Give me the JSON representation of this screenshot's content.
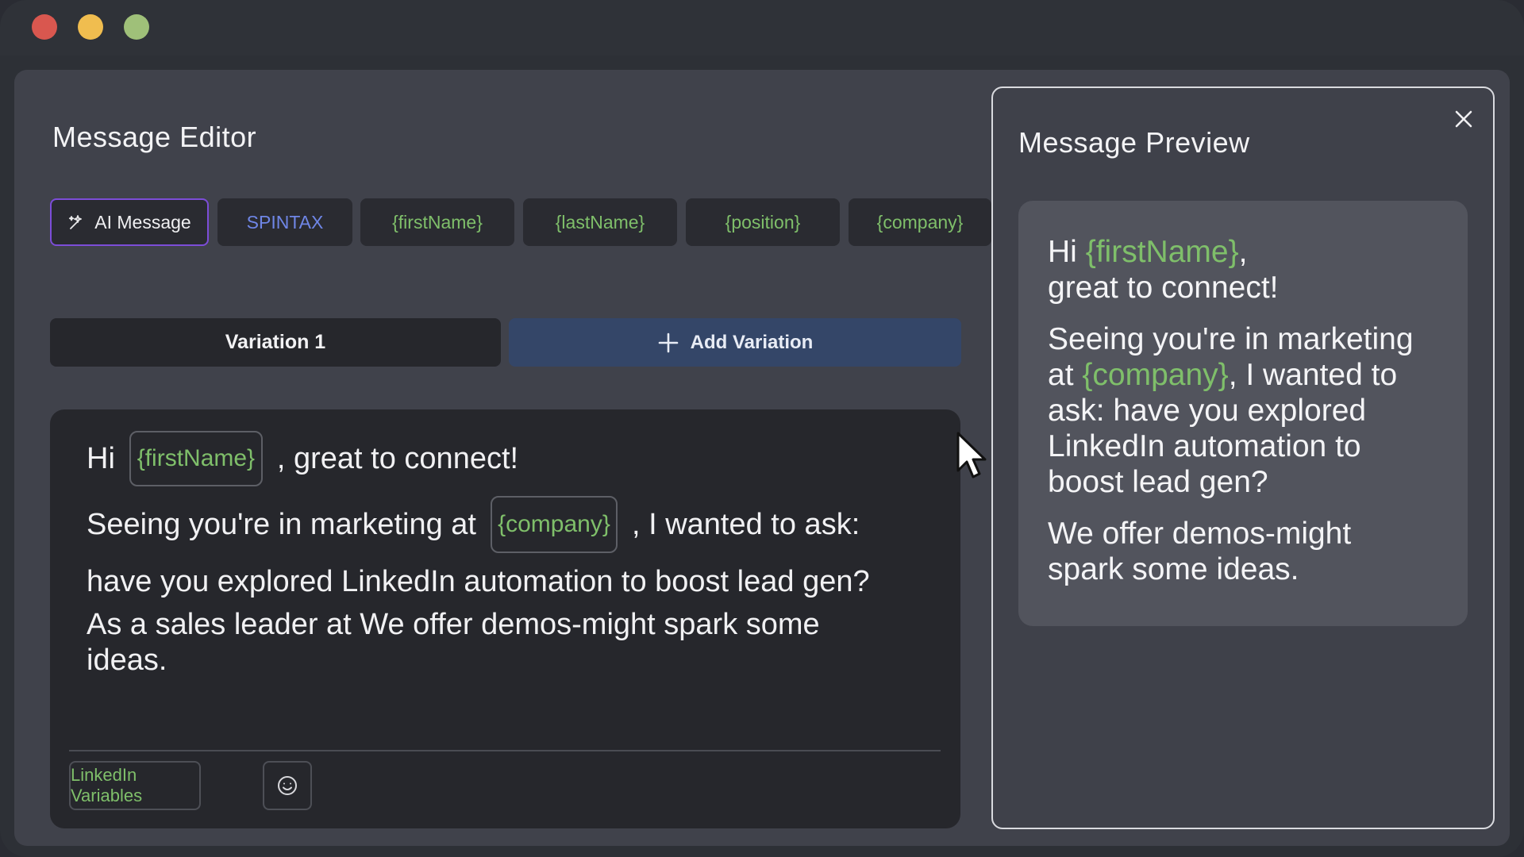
{
  "editor": {
    "title": "Message Editor",
    "chips": {
      "ai": "AI Message",
      "spintax": "SPINTAX",
      "firstName": "{firstName}",
      "lastName": "{lastName}",
      "position": "{position}",
      "company": "{company}"
    },
    "variation_tab": "Variation 1",
    "add_variation": "Add Variation",
    "message": {
      "hi": "Hi",
      "var_firstName": "{firstName}",
      "after_firstName": ", great to connect!",
      "seeing": "Seeing you're in marketing at",
      "var_company": "{company}",
      "after_company": ", I wanted to ask:",
      "line3": "have you explored LinkedIn automation to boost lead gen?",
      "line4": "As a sales leader at  We offer demos-might spark some",
      "line5": "ideas."
    },
    "linkedin_variables": "LinkedIn Variables"
  },
  "preview": {
    "title": "Message Preview",
    "hi": "Hi",
    "firstName": "{firstName}",
    "comma": ",",
    "great": "great to connect!",
    "p2a": "Seeing you're in marketing",
    "p2b_at": "at",
    "company": "{company}",
    "p2b_rest": ", I wanted to",
    "p2c": "ask: have you explored",
    "p2d": "LinkedIn automation to",
    "p2e": "boost lead gen?",
    "p3a": "We offer demos-might",
    "p3b": "spark some ideas."
  },
  "colors": {
    "variable_green": "#7fbf6a",
    "spintax_blue": "#6f86e6",
    "ai_border_purple": "#7c4dd8",
    "add_variation_bg": "#344668"
  }
}
